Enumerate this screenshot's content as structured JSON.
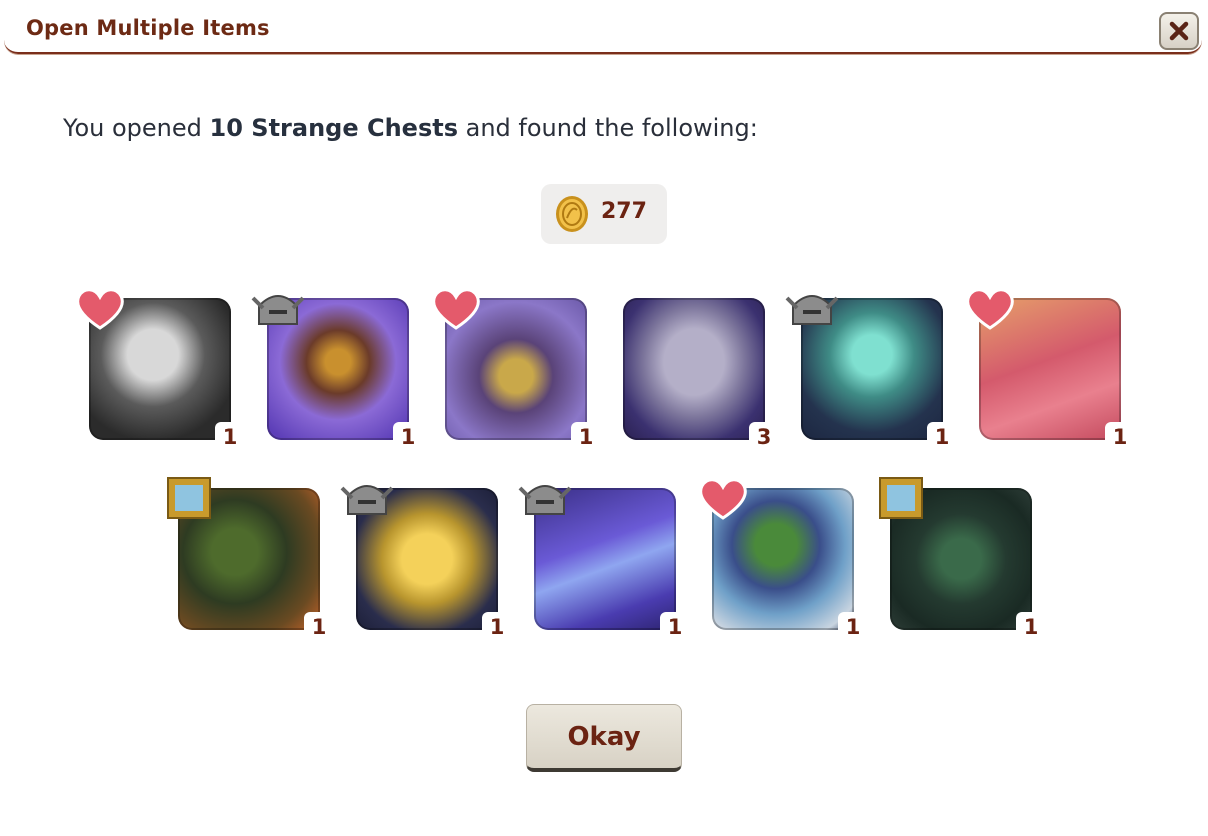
{
  "dialog": {
    "title": "Open Multiple Items",
    "close_icon": "close-icon"
  },
  "message": {
    "prefix": "You opened ",
    "bold": "10 Strange Chests",
    "suffix": " and found the following:"
  },
  "gold": {
    "icon": "gold-coin-icon",
    "amount": "277"
  },
  "items": [
    {
      "name": "scroll",
      "badge": "heart",
      "qty": "1"
    },
    {
      "name": "crossed-wings",
      "badge": "helmet",
      "qty": "1"
    },
    {
      "name": "spirit-mask",
      "badge": "heart",
      "qty": "1"
    },
    {
      "name": "purple-egg",
      "badge": "none",
      "qty": "3"
    },
    {
      "name": "teal-spirit",
      "badge": "helmet",
      "qty": "1"
    },
    {
      "name": "red-wings",
      "badge": "heart",
      "qty": "1"
    },
    {
      "name": "cauldron-scene",
      "badge": "frame",
      "qty": "1"
    },
    {
      "name": "gold-spirit",
      "badge": "helmet",
      "qty": "1"
    },
    {
      "name": "crystal-shard",
      "badge": "helmet",
      "qty": "1"
    },
    {
      "name": "forest-beast",
      "badge": "heart",
      "qty": "1"
    },
    {
      "name": "cave-scene",
      "badge": "frame",
      "qty": "1"
    }
  ],
  "okay_label": "Okay",
  "colors": {
    "accent": "#6b2312",
    "header_border": "#7a2e1b",
    "text": "#2a2f3a"
  }
}
